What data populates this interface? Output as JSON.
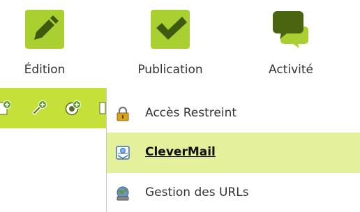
{
  "tabs": [
    {
      "label": "Édition",
      "icon": "pencil-icon"
    },
    {
      "label": "Publication",
      "icon": "checkmark-icon"
    },
    {
      "label": "Activité",
      "icon": "speech-bubbles-icon"
    }
  ],
  "toolbar": {
    "icons": [
      "add-page-icon",
      "add-link-icon",
      "add-widget-icon",
      "more-icon"
    ]
  },
  "menu": {
    "items": [
      {
        "label": "Accès Restreint",
        "icon": "padlock-icon",
        "highlighted": false
      },
      {
        "label": "CleverMail",
        "icon": "newsletter-icon",
        "highlighted": true
      },
      {
        "label": "Gestion des URLs",
        "icon": "globe-icon",
        "highlighted": false
      }
    ]
  },
  "colors": {
    "accent": "#a9cf30",
    "toolbar": "#c6e03a",
    "highlight": "#e4f09a",
    "dark_green": "#4a6410"
  }
}
